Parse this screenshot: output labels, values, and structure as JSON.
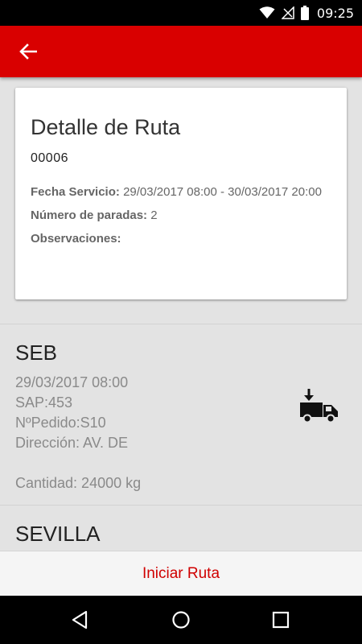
{
  "status_bar": {
    "time": "09:25"
  },
  "app_bar": {
    "back_icon": "arrow-left-icon",
    "color": "#d90000"
  },
  "route_card": {
    "title": "Detalle de Ruta",
    "code": "00006",
    "service_date_label": "Fecha Servicio:",
    "service_date_value": "29/03/2017 08:00 - 30/03/2017 20:00",
    "stops_label": "Número de paradas:",
    "stops_value": "2",
    "notes_label": "Observaciones:",
    "notes_value": ""
  },
  "stops": [
    {
      "name": "SEB",
      "datetime": "29/03/2017 08:00",
      "sap": "SAP:453",
      "order": "NºPedido:S10",
      "address": "Dirección: AV. DE",
      "quantity": "Cantidad: 24000 kg",
      "icon": "truck-unload-icon"
    },
    {
      "name": "SEVILLA"
    }
  ],
  "bottom_action": {
    "label": "Iniciar Ruta",
    "color": "#d00000"
  },
  "nav_bar": {
    "icons": [
      "back-triangle-icon",
      "home-circle-icon",
      "recents-square-icon"
    ]
  }
}
